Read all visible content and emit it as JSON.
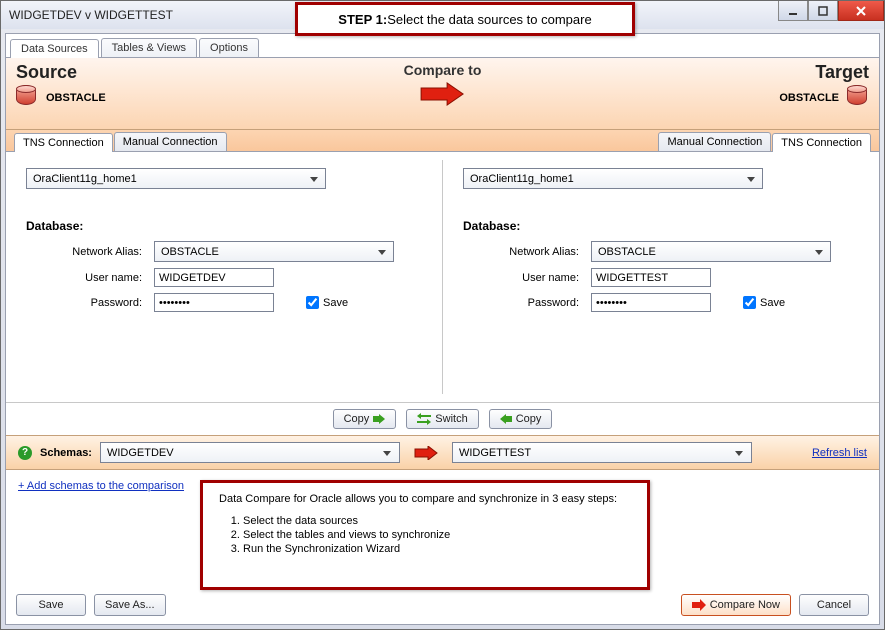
{
  "window": {
    "title": "WIDGETDEV v WIDGETTEST"
  },
  "callout": {
    "bold": "STEP 1: ",
    "text": "Select the data sources to compare"
  },
  "mainTabs": {
    "t0": "Data Sources",
    "t1": "Tables & Views",
    "t2": "Options"
  },
  "header": {
    "sourceLabel": "Source",
    "compareLabel": "Compare to",
    "targetLabel": "Target",
    "sourceName": "OBSTACLE",
    "targetName": "OBSTACLE"
  },
  "connTabs": {
    "tns": "TNS Connection",
    "manual": "Manual Connection"
  },
  "form": {
    "homeLeft": "OraClient11g_home1",
    "homeRight": "OraClient11g_home1",
    "dbLabel": "Database:",
    "networkAlias": "Network Alias:",
    "userName": "User name:",
    "password": "Password:",
    "saveLabel": "Save",
    "left": {
      "alias": "OBSTACLE",
      "user": "WIDGETDEV",
      "pw": "********"
    },
    "right": {
      "alias": "OBSTACLE",
      "user": "WIDGETTEST",
      "pw": "********"
    }
  },
  "csbar": {
    "copyR": "Copy",
    "switch": "Switch",
    "copyL": "Copy"
  },
  "schemas": {
    "label": "Schemas:",
    "left": "WIDGETDEV",
    "right": "WIDGETTEST",
    "refresh": "Refresh list"
  },
  "lower": {
    "addLink": "+ Add schemas to the comparison",
    "intro": "Data Compare for Oracle allows you to compare and synchronize in 3 easy steps:",
    "s1": "Select the data sources",
    "s2": "Select the tables and views to synchronize",
    "s3": "Run the Synchronization Wizard"
  },
  "bottom": {
    "save": "Save",
    "saveAs": "Save As...",
    "compareNow": "Compare Now",
    "cancel": "Cancel"
  }
}
